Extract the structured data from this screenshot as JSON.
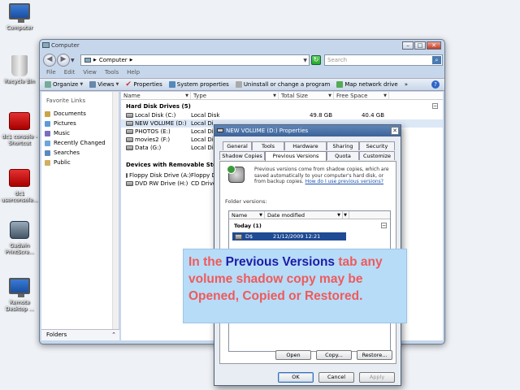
{
  "desktop": {
    "icons": [
      {
        "label": "Computer"
      },
      {
        "label": "Recycle Bin"
      },
      {
        "label": "dc1 console - Shortcut"
      },
      {
        "label": "dc1 userconsole..."
      },
      {
        "label": "Gadwin PrintScre..."
      },
      {
        "label": "Remote Desktop ..."
      }
    ]
  },
  "explorer": {
    "title": "Computer",
    "address": "Computer",
    "search_placeholder": "Search",
    "menu": [
      "File",
      "Edit",
      "View",
      "Tools",
      "Help"
    ],
    "toolbar": {
      "organize": "Organize",
      "views": "Views",
      "properties": "Properties",
      "system_properties": "System properties",
      "uninstall": "Uninstall or change a program",
      "map_drive": "Map network drive",
      "more": "»"
    },
    "favorites_heading": "Favorite Links",
    "favorites": [
      "Documents",
      "Pictures",
      "Music",
      "Recently Changed",
      "Searches",
      "Public"
    ],
    "folders_label": "Folders",
    "columns": {
      "name": "Name",
      "type": "Type",
      "total": "Total Size",
      "free": "Free Space"
    },
    "hard_disk_group": "Hard Disk Drives (5)",
    "hard_disks": [
      {
        "name": "Local Disk (C:)",
        "type": "Local Disk",
        "total": "49.8 GB",
        "free": "40.4 GB"
      },
      {
        "name": "NEW VOLUME (D:)",
        "type": "Local Di",
        "total": "",
        "free": ""
      },
      {
        "name": "PHOTOS (E:)",
        "type": "Local Di",
        "total": "",
        "free": ""
      },
      {
        "name": "movies2 (F:)",
        "type": "Local Di",
        "total": "",
        "free": ""
      },
      {
        "name": "Data (G:)",
        "type": "Local Di",
        "total": "",
        "free": ""
      }
    ],
    "removable_group": "Devices with Removable Stora",
    "removable": [
      {
        "name": "Floppy Disk Drive (A:)",
        "type": "Floppy D"
      },
      {
        "name": "DVD RW Drive (H:)",
        "type": "CD Drive"
      }
    ]
  },
  "dialog": {
    "title": "NEW VOLUME (D:) Properties",
    "tabs_row1": [
      "General",
      "Tools",
      "Hardware",
      "Sharing",
      "Security"
    ],
    "tabs_row2": [
      "Shadow Copies",
      "Previous Versions",
      "Quota",
      "Customize"
    ],
    "info_text": "Previous versions come from shadow copies, which are saved automatically to your computer's hard disk, or from backup copies.",
    "info_link": "How do I use previous versions?",
    "folder_versions_label": "Folder versions:",
    "list_cols": {
      "name": "Name",
      "date": "Date modified"
    },
    "group_today": "Today (1)",
    "version_row": {
      "name": "D$",
      "date": "21/12/2009 12:21"
    },
    "buttons": {
      "open": "Open",
      "copy": "Copy...",
      "restore": "Restore..."
    },
    "footer": {
      "ok": "OK",
      "cancel": "Cancel",
      "apply": "Apply"
    }
  },
  "callout": {
    "part1": "In the ",
    "highlight": "Previous Versions",
    "part2": " tab any volume shadow copy may be Opened, Copied or Restored."
  }
}
